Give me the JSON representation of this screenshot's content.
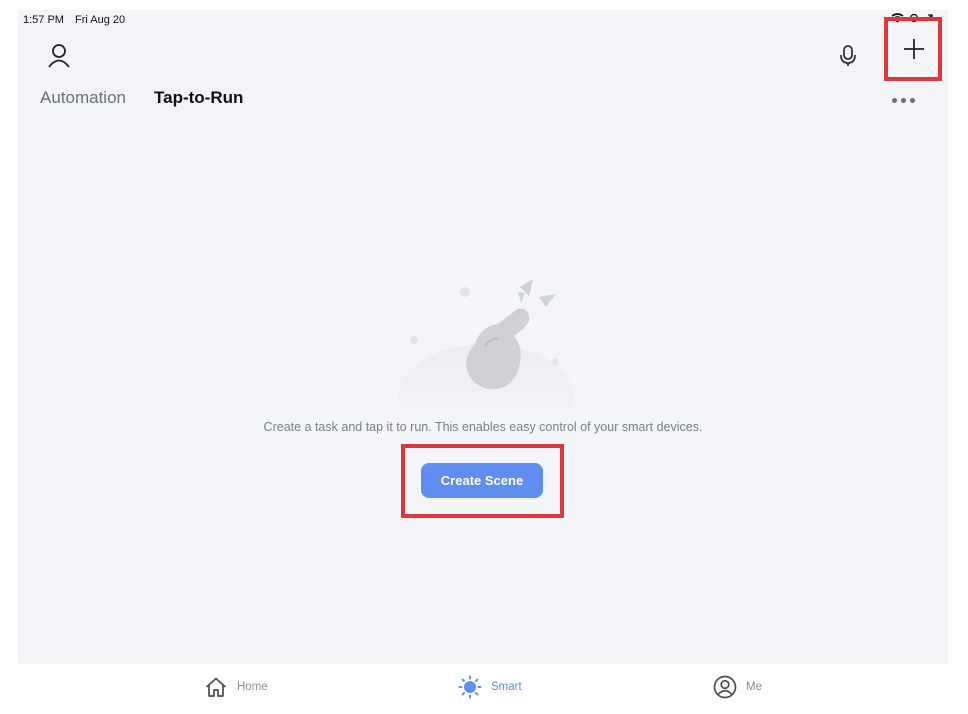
{
  "status_bar": {
    "time": "1:57 PM",
    "date": "Fri Aug 20",
    "icons": [
      "wifi-icon",
      "location-icon",
      "signal-icon"
    ]
  },
  "header": {
    "icons": [
      "profile-icon",
      "microphone-icon",
      "plus-icon",
      "more-icon"
    ]
  },
  "tabs": [
    {
      "label": "Automation",
      "active": false
    },
    {
      "label": "Tap-to-Run",
      "active": true
    }
  ],
  "empty_state": {
    "illustration": "tap-hand-illustration",
    "message": "Create a task and tap it to run. This enables easy control of your smart devices.",
    "button_label": "Create Scene"
  },
  "bottom_nav": [
    {
      "label": "Home",
      "icon": "home-icon",
      "active": false
    },
    {
      "label": "Smart",
      "icon": "smart-sun-icon",
      "active": true
    },
    {
      "label": "Me",
      "icon": "me-icon",
      "active": false
    }
  ],
  "colors": {
    "accent": "#5f8ef0",
    "highlight": "#e0373f",
    "background": "#f4f5f8",
    "inactive_text": "#8a8d92"
  }
}
